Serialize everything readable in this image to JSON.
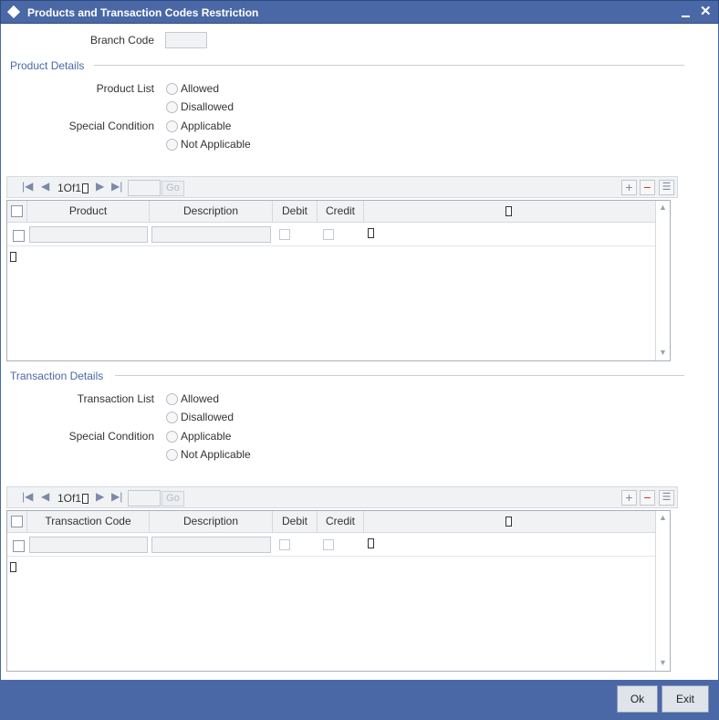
{
  "window": {
    "title": "Products and Transaction Codes Restriction"
  },
  "branch": {
    "label": "Branch Code",
    "value": ""
  },
  "product_details": {
    "title": "Product Details",
    "list_label": "Product List",
    "list_options": [
      "Allowed",
      "Disallowed"
    ],
    "special_label": "Special Condition",
    "special_options": [
      "Applicable",
      "Not Applicable"
    ],
    "grid": {
      "page_text": "1Of1",
      "go_label": "Go",
      "columns": [
        "Product",
        "Description",
        "Debit",
        "Credit"
      ],
      "rows": [
        {
          "col1": "",
          "description": ""
        }
      ]
    }
  },
  "transaction_details": {
    "title": "Transaction Details",
    "list_label": "Transaction List",
    "list_options": [
      "Allowed",
      "Disallowed"
    ],
    "special_label": "Special Condition",
    "special_options": [
      "Applicable",
      "Not Applicable"
    ],
    "grid": {
      "page_text": "1Of1",
      "go_label": "Go",
      "columns": [
        "Transaction Code",
        "Description",
        "Debit",
        "Credit"
      ],
      "rows": [
        {
          "col1": "",
          "description": ""
        }
      ]
    }
  },
  "toolbar_icons": [
    "first-page-icon",
    "prev-page-icon",
    "next-page-icon",
    "last-page-icon",
    "add-row-icon",
    "delete-row-icon",
    "single-view-icon"
  ],
  "footer": {
    "ok_label": "Ok",
    "exit_label": "Exit"
  },
  "colors": {
    "header": "#4a68a6",
    "section_title": "#4a68a6"
  }
}
